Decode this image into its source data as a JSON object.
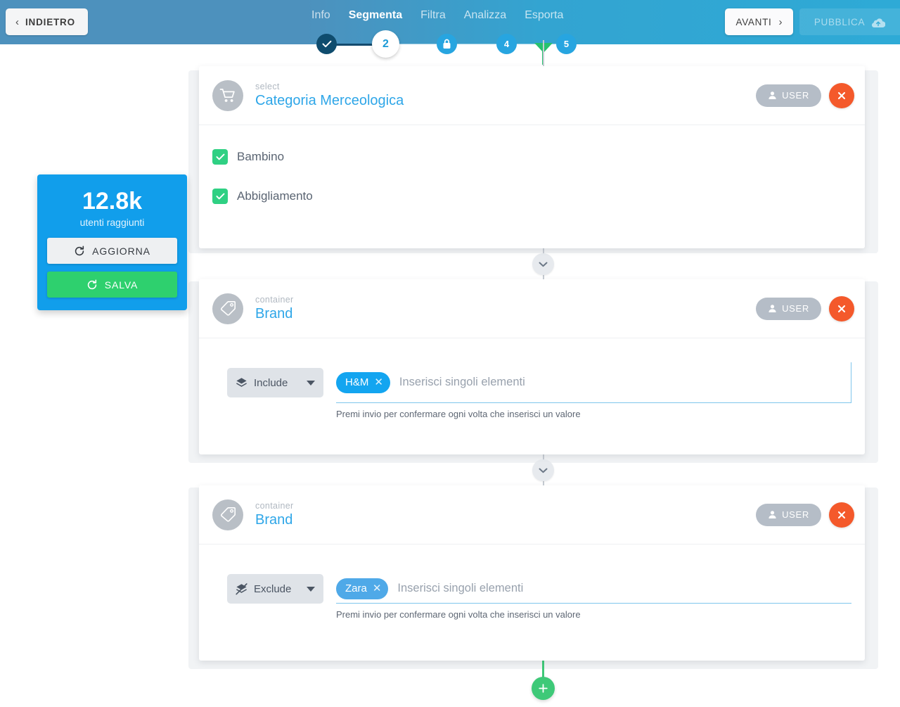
{
  "topbar": {
    "back_label": "INDIETRO",
    "back_icon": "chevron-left-icon",
    "next_label": "AVANTI",
    "next_icon": "chevron-right-icon",
    "publish_label": "PUBBLICA",
    "publish_icon": "cloud-upload-icon",
    "nav": [
      {
        "label": "Info",
        "active": false
      },
      {
        "label": "Segmenta",
        "active": true
      },
      {
        "label": "Filtra",
        "active": false
      },
      {
        "label": "Analizza",
        "active": false
      },
      {
        "label": "Esporta",
        "active": false
      }
    ],
    "steps": [
      {
        "label": "✓",
        "state": "done"
      },
      {
        "label": "2",
        "state": "current"
      },
      {
        "label": "lock-icon",
        "state": "locked"
      },
      {
        "label": "4",
        "state": "upcoming"
      },
      {
        "label": "5",
        "state": "upcoming"
      }
    ],
    "colors": {
      "bar_left": "#4d91bd",
      "bar_right": "#2eaad6",
      "step_done": "#0f4c6e",
      "step_blue": "#27a5e0",
      "marker_green": "#27c16f"
    }
  },
  "stats": {
    "value": "12.8k",
    "caption": "utenti raggiunti",
    "refresh_label": "AGGIORNA",
    "refresh_icon": "refresh-icon",
    "save_label": "SALVA",
    "save_icon": "refresh-icon",
    "colors": {
      "panel": "#119eeb",
      "save": "#2ed06e",
      "refresh": "#eef0f2"
    }
  },
  "cards": [
    {
      "kind": "select",
      "title": "Categoria Merceologica",
      "icon": "shopping-cart-icon",
      "user_badge": "USER",
      "user_icon": "person-icon",
      "close_icon": "close-icon",
      "type": "checkbox",
      "options": [
        {
          "label": "Bambino",
          "checked": true
        },
        {
          "label": "Abbigliamento",
          "checked": true
        }
      ]
    },
    {
      "kind": "container",
      "title": "Brand",
      "icon": "tag-icon",
      "user_badge": "USER",
      "user_icon": "person-icon",
      "close_icon": "close-icon",
      "type": "chips",
      "mode_label": "Include",
      "mode_icon": "layers-icon",
      "chip": {
        "label": "H&M",
        "color": "#13a5f0",
        "remove_icon": "close-icon"
      },
      "placeholder": "Inserisci singoli elementi",
      "hint": "Premi invio per confermare ogni volta che inserisci un valore",
      "focused": true
    },
    {
      "kind": "container",
      "title": "Brand",
      "icon": "tag-icon",
      "user_badge": "USER",
      "user_icon": "person-icon",
      "close_icon": "close-icon",
      "type": "chips",
      "mode_label": "Exclude",
      "mode_icon": "layers-off-icon",
      "chip": {
        "label": "Zara",
        "color": "#4fa9e8",
        "remove_icon": "close-icon"
      },
      "placeholder": "Inserisci singoli elementi",
      "hint": "Premi invio per confermare ogni volta che inserisci un valore",
      "focused": false
    }
  ],
  "connectors": {
    "chevron_icon": "chevron-down-icon",
    "add_icon": "plus-icon"
  }
}
